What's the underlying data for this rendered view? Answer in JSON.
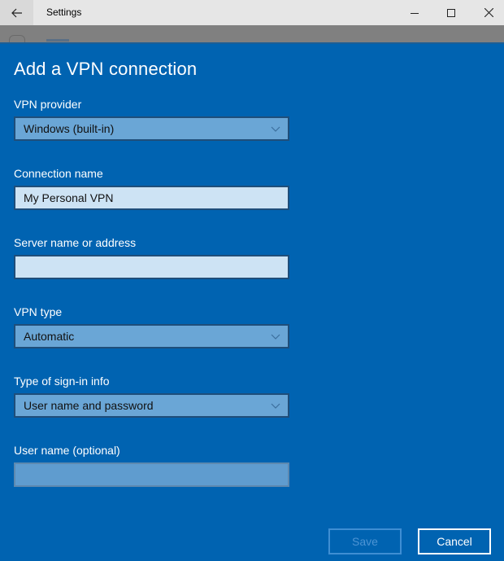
{
  "window": {
    "title": "Settings",
    "controls": {
      "back": "back-arrow-icon",
      "minimize": "minimize-icon",
      "maximize": "maximize-icon",
      "close": "close-icon"
    }
  },
  "dialog": {
    "heading": "Add a VPN connection",
    "fields": [
      {
        "label": "VPN provider",
        "type": "select",
        "value": "Windows (built-in)"
      },
      {
        "label": "Connection name",
        "type": "text",
        "value": "My Personal VPN"
      },
      {
        "label": "Server name or address",
        "type": "text",
        "value": ""
      },
      {
        "label": "VPN type",
        "type": "select",
        "value": "Automatic"
      },
      {
        "label": "Type of sign-in info",
        "type": "select",
        "value": "User name and password"
      },
      {
        "label": "User name (optional)",
        "type": "text",
        "value": "",
        "disabled": true
      }
    ],
    "buttons": {
      "save": "Save",
      "cancel": "Cancel",
      "save_enabled": false
    },
    "colors": {
      "accent": "#0063b1",
      "select_bg": "#6aa6d6",
      "input_bg": "#cde3f4"
    }
  }
}
